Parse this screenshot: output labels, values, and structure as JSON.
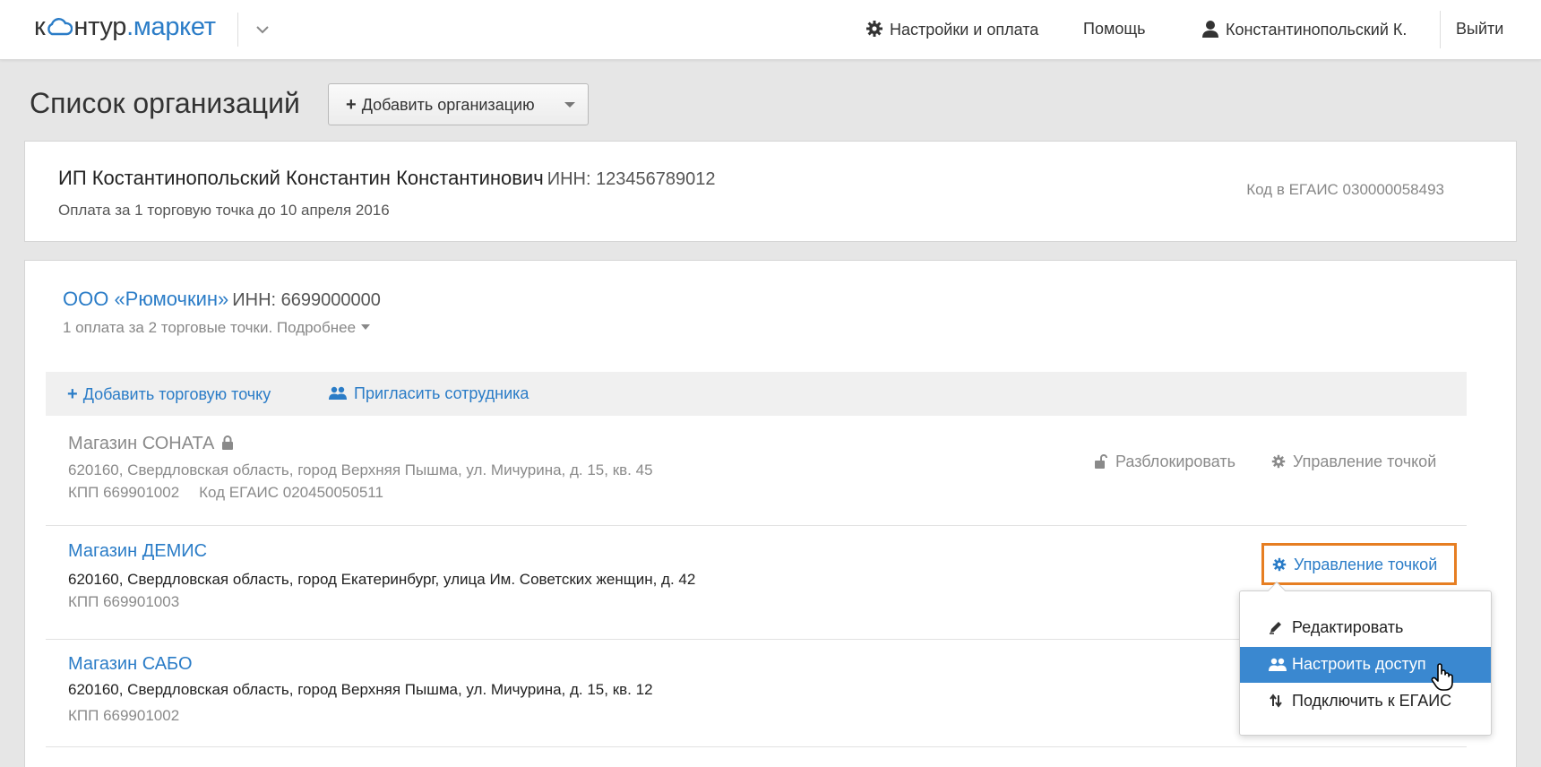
{
  "header": {
    "logo_part1": "к",
    "logo_part2": "нтур",
    "logo_dot": ".",
    "logo_part3": "маркет",
    "settings": "Настройки и оплата",
    "help": "Помощь",
    "user": "Константинопольский К.",
    "logout": "Выйти"
  },
  "page": {
    "title": "Список организаций",
    "add_org_button": "Добавить организацию"
  },
  "ip_card": {
    "name": "ИП Костантинопольский Константин Константинович",
    "inn": "ИНН: 123456789012",
    "payment": "Оплата за 1 торговую точка до 10 апреля 2016",
    "egais": "Код в ЕГАИС 030000058493"
  },
  "org_card": {
    "name": "ООО «Рюмочкин»",
    "inn": "ИНН: 6699000000",
    "payment": "1 оплата за 2 торговые точки. Подробнее",
    "add_shop": "Добавить торговую точку",
    "invite": "Пригласить сотрудника",
    "shops": [
      {
        "name": "Магазин СОНАТА",
        "address": "620160, Свердловская область, город Верхняя Пышма, ул. Мичурина, д. 15, кв. 45",
        "kpp": "КПП 669901002",
        "egais": "Код ЕГАИС 020450050511",
        "unlock": "Разблокировать",
        "manage": "Управление точкой"
      },
      {
        "name": "Магазин ДЕМИС",
        "address": "620160, Свердловская область, город Екатеринбург, улица Им. Советских женщин, д. 42",
        "kpp": "КПП 669901003",
        "manage": "Управление точкой"
      },
      {
        "name": "Магазин САБО",
        "address": "620160, Свердловская область, город Верхняя Пышма, ул. Мичурина, д. 15, кв. 12",
        "kpp": "КПП 669901002"
      }
    ]
  },
  "dropdown": {
    "edit": "Редактировать",
    "access": "Настроить доступ",
    "egais": "Подключить к ЕГАИС"
  },
  "colors": {
    "link": "#2a7cc7",
    "highlight": "#e67e22",
    "selected": "#3a88d0"
  }
}
